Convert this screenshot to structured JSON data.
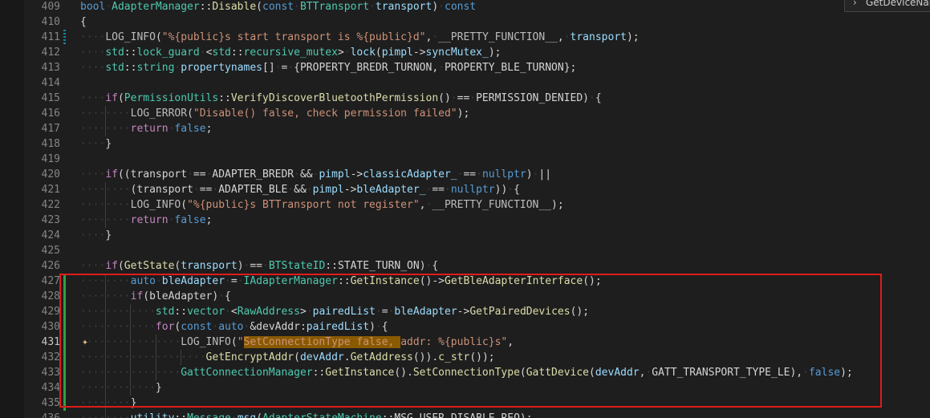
{
  "editor": {
    "search_widget_text": "GetDeviceNam",
    "lines": [
      {
        "num": "409",
        "indent": 0,
        "tokens": [
          [
            "t-kw",
            "bool"
          ],
          [
            "t-type",
            "AdapterManager"
          ],
          [
            "t-punc",
            "::"
          ],
          [
            "t-fn",
            "Disable"
          ],
          [
            "t-punc",
            "("
          ],
          [
            "t-kw",
            "const"
          ],
          [
            "t-type",
            "BTTransport"
          ],
          [
            "t-var",
            "transport"
          ],
          [
            "t-punc",
            ")"
          ],
          [
            "t-kw",
            "const"
          ]
        ]
      },
      {
        "num": "410",
        "indent": 0,
        "tokens": [
          [
            "t-punc",
            "{"
          ]
        ]
      },
      {
        "num": "411",
        "indent": 1,
        "marker": "modified",
        "tokens": [
          [
            "t-macro",
            "LOG_INFO"
          ],
          [
            "t-punc",
            "("
          ],
          [
            "t-str",
            "\"%{public}s start transport is %{public}d\""
          ],
          [
            "t-punc",
            ","
          ],
          [
            "t-macro",
            "__PRETTY_FUNCTION__"
          ],
          [
            "t-punc",
            ","
          ],
          [
            "t-var",
            "transport"
          ],
          [
            "t-punc",
            ");"
          ]
        ]
      },
      {
        "num": "412",
        "indent": 1,
        "tokens": [
          [
            "t-type",
            "std"
          ],
          [
            "t-punc",
            "::"
          ],
          [
            "t-type",
            "lock_guard"
          ],
          [
            "t-punc",
            "<"
          ],
          [
            "t-type",
            "std"
          ],
          [
            "t-punc",
            "::"
          ],
          [
            "t-type",
            "recursive_mutex"
          ],
          [
            "t-punc",
            ">"
          ],
          [
            "t-var",
            "lock"
          ],
          [
            "t-punc",
            "("
          ],
          [
            "t-var",
            "pimpl"
          ],
          [
            "t-punc",
            "->"
          ],
          [
            "t-var",
            "syncMutex_"
          ],
          [
            "t-punc",
            ");"
          ]
        ]
      },
      {
        "num": "413",
        "indent": 1,
        "tokens": [
          [
            "t-type",
            "std"
          ],
          [
            "t-punc",
            "::"
          ],
          [
            "t-type",
            "string"
          ],
          [
            "t-var",
            "propertynames"
          ],
          [
            "t-punc",
            "[]"
          ],
          [
            "t-punc",
            "="
          ],
          [
            "t-punc",
            "{PROPERTY_BREDR_TURNON,"
          ],
          [
            "t-punc",
            "PROPERTY_BLE_TURNON};"
          ]
        ]
      },
      {
        "num": "414",
        "indent": 0,
        "tokens": []
      },
      {
        "num": "415",
        "indent": 1,
        "tokens": [
          [
            "t-ctrl",
            "if"
          ],
          [
            "t-punc",
            "("
          ],
          [
            "t-type",
            "PermissionUtils"
          ],
          [
            "t-punc",
            "::"
          ],
          [
            "t-fn",
            "VerifyDiscoverBluetoothPermission"
          ],
          [
            "t-punc",
            "()"
          ],
          [
            "t-punc",
            "=="
          ],
          [
            "t-punc",
            "PERMISSION_DENIED)"
          ],
          [
            "t-punc",
            "{"
          ]
        ]
      },
      {
        "num": "416",
        "indent": 2,
        "tokens": [
          [
            "t-macro",
            "LOG_ERROR"
          ],
          [
            "t-punc",
            "("
          ],
          [
            "t-str",
            "\"Disable() false, check permission failed\""
          ],
          [
            "t-punc",
            ");"
          ]
        ]
      },
      {
        "num": "417",
        "indent": 2,
        "tokens": [
          [
            "t-ctrl",
            "return"
          ],
          [
            "t-kw",
            "false"
          ],
          [
            "t-punc",
            ";"
          ]
        ]
      },
      {
        "num": "418",
        "indent": 1,
        "tokens": [
          [
            "t-punc",
            "}"
          ]
        ]
      },
      {
        "num": "419",
        "indent": 0,
        "tokens": []
      },
      {
        "num": "420",
        "indent": 1,
        "tokens": [
          [
            "t-ctrl",
            "if"
          ],
          [
            "t-punc",
            "((transport"
          ],
          [
            "t-punc",
            "=="
          ],
          [
            "t-punc",
            "ADAPTER_BREDR"
          ],
          [
            "t-punc",
            "&&"
          ],
          [
            "t-var",
            "pimpl"
          ],
          [
            "t-punc",
            "->"
          ],
          [
            "t-var",
            "classicAdapter_"
          ],
          [
            "t-punc",
            "=="
          ],
          [
            "t-kw",
            "nullptr"
          ],
          [
            "t-punc",
            ")"
          ],
          [
            "t-punc",
            "||"
          ]
        ]
      },
      {
        "num": "421",
        "indent": 2,
        "tokens": [
          [
            "t-punc",
            "(transport"
          ],
          [
            "t-punc",
            "=="
          ],
          [
            "t-punc",
            "ADAPTER_BLE"
          ],
          [
            "t-punc",
            "&&"
          ],
          [
            "t-var",
            "pimpl"
          ],
          [
            "t-punc",
            "->"
          ],
          [
            "t-var",
            "bleAdapter_"
          ],
          [
            "t-punc",
            "=="
          ],
          [
            "t-kw",
            "nullptr"
          ],
          [
            "t-punc",
            "))"
          ],
          [
            "t-punc",
            "{"
          ]
        ]
      },
      {
        "num": "422",
        "indent": 2,
        "tokens": [
          [
            "t-macro",
            "LOG_INFO"
          ],
          [
            "t-punc",
            "("
          ],
          [
            "t-str",
            "\"%{public}s BTTransport not register\""
          ],
          [
            "t-punc",
            ","
          ],
          [
            "t-macro",
            "__PRETTY_FUNCTION__"
          ],
          [
            "t-punc",
            ");"
          ]
        ]
      },
      {
        "num": "423",
        "indent": 2,
        "tokens": [
          [
            "t-ctrl",
            "return"
          ],
          [
            "t-kw",
            "false"
          ],
          [
            "t-punc",
            ";"
          ]
        ]
      },
      {
        "num": "424",
        "indent": 1,
        "tokens": [
          [
            "t-punc",
            "}"
          ]
        ]
      },
      {
        "num": "425",
        "indent": 0,
        "tokens": []
      },
      {
        "num": "426",
        "indent": 1,
        "tokens": [
          [
            "t-ctrl",
            "if"
          ],
          [
            "t-punc",
            "("
          ],
          [
            "t-fn",
            "GetState"
          ],
          [
            "t-punc",
            "("
          ],
          [
            "t-var",
            "transport"
          ],
          [
            "t-punc",
            ")"
          ],
          [
            "t-punc",
            "=="
          ],
          [
            "t-type",
            "BTStateID"
          ],
          [
            "t-punc",
            "::STATE_TURN_ON)"
          ],
          [
            "t-punc",
            "{"
          ]
        ]
      },
      {
        "num": "427",
        "indent": 2,
        "marker": "added",
        "tokens": [
          [
            "t-kw",
            "auto"
          ],
          [
            "t-var",
            "bleAdapter"
          ],
          [
            "t-punc",
            "="
          ],
          [
            "t-type",
            "IAdapterManager"
          ],
          [
            "t-punc",
            "::"
          ],
          [
            "t-fn",
            "GetInstance"
          ],
          [
            "t-punc",
            "()->"
          ],
          [
            "t-fn",
            "GetBleAdapterInterface"
          ],
          [
            "t-punc",
            "();"
          ]
        ]
      },
      {
        "num": "428",
        "indent": 2,
        "marker": "added",
        "tokens": [
          [
            "t-ctrl",
            "if"
          ],
          [
            "t-punc",
            "(bleAdapter)"
          ],
          [
            "t-punc",
            "{"
          ]
        ]
      },
      {
        "num": "429",
        "indent": 3,
        "marker": "added",
        "tokens": [
          [
            "t-type",
            "std"
          ],
          [
            "t-punc",
            "::"
          ],
          [
            "t-type",
            "vector"
          ],
          [
            "t-punc",
            "<"
          ],
          [
            "t-type",
            "RawAddress"
          ],
          [
            "t-punc",
            ">"
          ],
          [
            "t-var",
            "pairedList"
          ],
          [
            "t-punc",
            "="
          ],
          [
            "t-var",
            "bleAdapter"
          ],
          [
            "t-punc",
            "->"
          ],
          [
            "t-fn",
            "GetPairedDevices"
          ],
          [
            "t-punc",
            "();"
          ]
        ]
      },
      {
        "num": "430",
        "indent": 3,
        "marker": "added",
        "tokens": [
          [
            "t-ctrl",
            "for"
          ],
          [
            "t-punc",
            "("
          ],
          [
            "t-kw",
            "const"
          ],
          [
            "t-kw",
            "auto"
          ],
          [
            "t-punc",
            "&devAddr"
          ],
          [
            "t-punc",
            ":"
          ],
          [
            "t-var",
            "pairedList"
          ],
          [
            "t-punc",
            ")"
          ],
          [
            "t-punc",
            "{"
          ]
        ]
      },
      {
        "num": "431",
        "indent": 4,
        "marker": "added",
        "active": true,
        "lightbulb": true,
        "tokens": [
          [
            "t-macro",
            "LOG_INFO"
          ],
          [
            "t-punc",
            "("
          ],
          [
            "t-str",
            "\""
          ],
          [
            "t-hl",
            "SetConnectionType false, "
          ],
          [
            "t-str",
            "addr: %{public}s\""
          ],
          [
            "t-punc",
            ","
          ]
        ]
      },
      {
        "num": "432",
        "indent": 5,
        "marker": "added",
        "tokens": [
          [
            "t-fn",
            "GetEncryptAddr"
          ],
          [
            "t-punc",
            "("
          ],
          [
            "t-var",
            "devAddr"
          ],
          [
            "t-punc",
            "."
          ],
          [
            "t-fn",
            "GetAddress"
          ],
          [
            "t-punc",
            "())."
          ],
          [
            "t-fn",
            "c_str"
          ],
          [
            "t-punc",
            "());"
          ]
        ]
      },
      {
        "num": "433",
        "indent": 4,
        "marker": "added",
        "tokens": [
          [
            "t-type",
            "GattConnectionManager"
          ],
          [
            "t-punc",
            "::"
          ],
          [
            "t-fn",
            "GetInstance"
          ],
          [
            "t-punc",
            "()."
          ],
          [
            "t-fn",
            "SetConnectionType"
          ],
          [
            "t-punc",
            "("
          ],
          [
            "t-fn",
            "GattDevice"
          ],
          [
            "t-punc",
            "("
          ],
          [
            "t-var",
            "devAddr"
          ],
          [
            "t-punc",
            ","
          ],
          [
            "t-punc",
            "GATT_TRANSPORT_TYPE_LE),"
          ],
          [
            "t-kw",
            "false"
          ],
          [
            "t-punc",
            ");"
          ]
        ]
      },
      {
        "num": "434",
        "indent": 3,
        "marker": "added",
        "tokens": [
          [
            "t-punc",
            "}"
          ]
        ]
      },
      {
        "num": "435",
        "indent": 2,
        "marker": "added",
        "tokens": [
          [
            "t-punc",
            "}"
          ]
        ]
      },
      {
        "num": "436",
        "indent": 2,
        "tokens": [
          [
            "t-var",
            "utility"
          ],
          [
            "t-punc",
            "::"
          ],
          [
            "t-type",
            "Message"
          ],
          [
            "t-var",
            "msg"
          ],
          [
            "t-punc",
            "("
          ],
          [
            "t-type",
            "AdapterStateMachine"
          ],
          [
            "t-punc",
            "::MSG_USER_DISABLE_REQ);"
          ]
        ]
      }
    ]
  }
}
